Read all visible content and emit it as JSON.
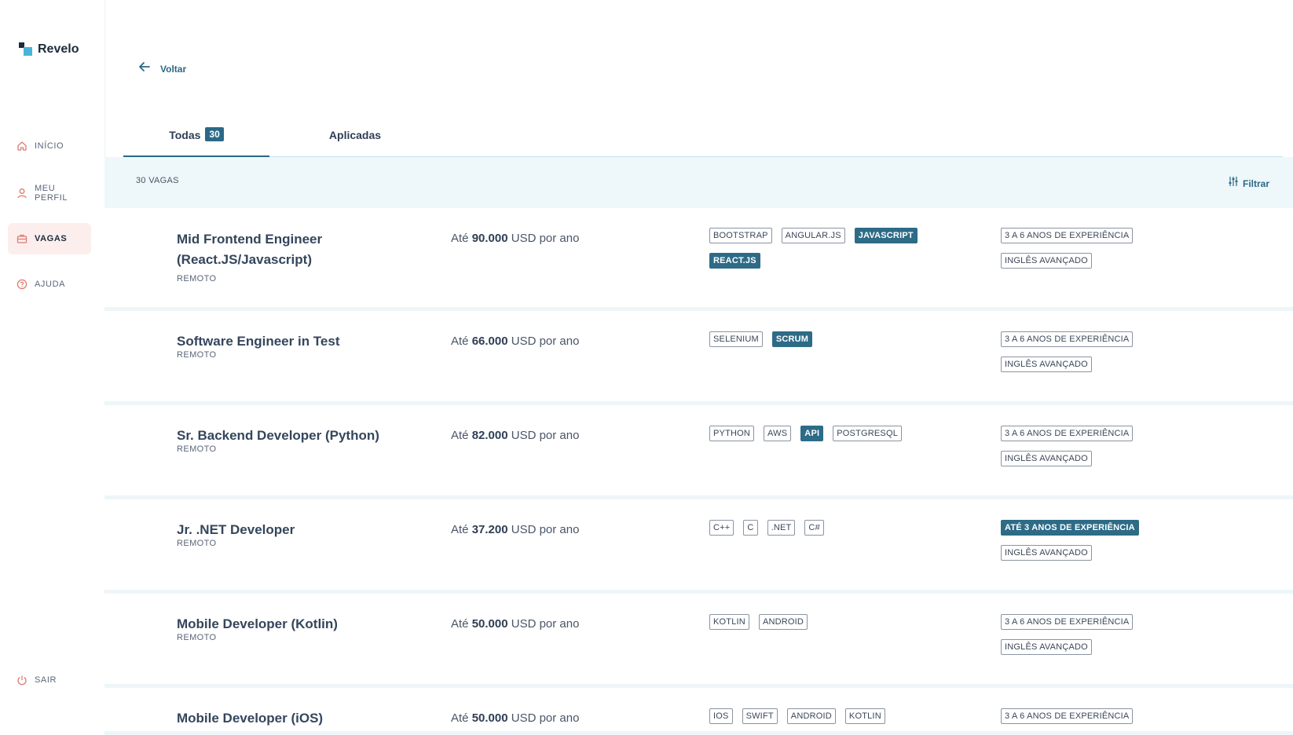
{
  "brand": {
    "name": "Revelo"
  },
  "sidebar": {
    "items": [
      {
        "label": "INÍCIO",
        "icon": "home-icon",
        "active": false
      },
      {
        "label": "MEU\nPERFIL",
        "icon": "user-icon",
        "active": false
      },
      {
        "label": "VAGAS",
        "icon": "briefcase-icon",
        "active": true
      },
      {
        "label": "AJUDA",
        "icon": "help-icon",
        "active": false
      }
    ],
    "logout": {
      "label": "SAIR",
      "icon": "power-icon"
    }
  },
  "back": {
    "label": "Voltar"
  },
  "tabs": [
    {
      "label": "Todas",
      "count": "30",
      "active": true
    },
    {
      "label": "Aplicadas",
      "active": false
    }
  ],
  "list_header": {
    "count_label": "30 VAGAS",
    "filter_label": "Filtrar"
  },
  "salary": {
    "prefix": "Até",
    "suffix": "USD por ano"
  },
  "jobs": [
    {
      "title": "Mid Frontend Engineer (React.JS/Javascript)",
      "location": "REMOTO",
      "salary": "90.000",
      "tags": [
        {
          "label": "BOOTSTRAP",
          "hl": false
        },
        {
          "label": "ANGULAR.JS",
          "hl": false
        },
        {
          "label": "JAVASCRIPT",
          "hl": true
        },
        {
          "label": "REACT.JS",
          "hl": true
        }
      ],
      "reqs": [
        {
          "label": "3 A 6 ANOS DE EXPERIÊNCIA",
          "hl": false
        },
        {
          "label": "INGLÊS AVANÇADO",
          "hl": false
        }
      ]
    },
    {
      "title": "Software Engineer in Test",
      "location": "REMOTO",
      "salary": "66.000",
      "tags": [
        {
          "label": "SELENIUM",
          "hl": false
        },
        {
          "label": "SCRUM",
          "hl": true
        }
      ],
      "reqs": [
        {
          "label": "3 A 6 ANOS DE EXPERIÊNCIA",
          "hl": false
        },
        {
          "label": "INGLÊS AVANÇADO",
          "hl": false
        }
      ]
    },
    {
      "title": "Sr. Backend Developer (Python)",
      "location": "REMOTO",
      "salary": "82.000",
      "tags": [
        {
          "label": "PYTHON",
          "hl": false
        },
        {
          "label": "AWS",
          "hl": false
        },
        {
          "label": "API",
          "hl": true
        },
        {
          "label": "POSTGRESQL",
          "hl": false
        }
      ],
      "reqs": [
        {
          "label": "3 A 6 ANOS DE EXPERIÊNCIA",
          "hl": false
        },
        {
          "label": "INGLÊS AVANÇADO",
          "hl": false
        }
      ]
    },
    {
      "title": "Jr. .NET Developer",
      "location": "REMOTO",
      "salary": "37.200",
      "tags": [
        {
          "label": "C++",
          "hl": false
        },
        {
          "label": "C",
          "hl": false
        },
        {
          "label": ".NET",
          "hl": false
        },
        {
          "label": "C#",
          "hl": false
        }
      ],
      "reqs": [
        {
          "label": "ATÉ 3 ANOS DE EXPERIÊNCIA",
          "hl": true
        },
        {
          "label": "INGLÊS AVANÇADO",
          "hl": false
        }
      ]
    },
    {
      "title": "Mobile Developer (Kotlin)",
      "location": "REMOTO",
      "salary": "50.000",
      "tags": [
        {
          "label": "KOTLIN",
          "hl": false
        },
        {
          "label": "ANDROID",
          "hl": false
        }
      ],
      "reqs": [
        {
          "label": "3 A 6 ANOS DE EXPERIÊNCIA",
          "hl": false
        },
        {
          "label": "INGLÊS AVANÇADO",
          "hl": false
        }
      ]
    },
    {
      "title": "Mobile Developer (iOS)",
      "location": "",
      "salary": "50.000",
      "tags": [
        {
          "label": "IOS",
          "hl": false
        },
        {
          "label": "SWIFT",
          "hl": false
        },
        {
          "label": "ANDROID",
          "hl": false
        },
        {
          "label": "KOTLIN",
          "hl": false
        }
      ],
      "reqs": [
        {
          "label": "3 A 6 ANOS DE EXPERIÊNCIA",
          "hl": false
        }
      ]
    }
  ]
}
